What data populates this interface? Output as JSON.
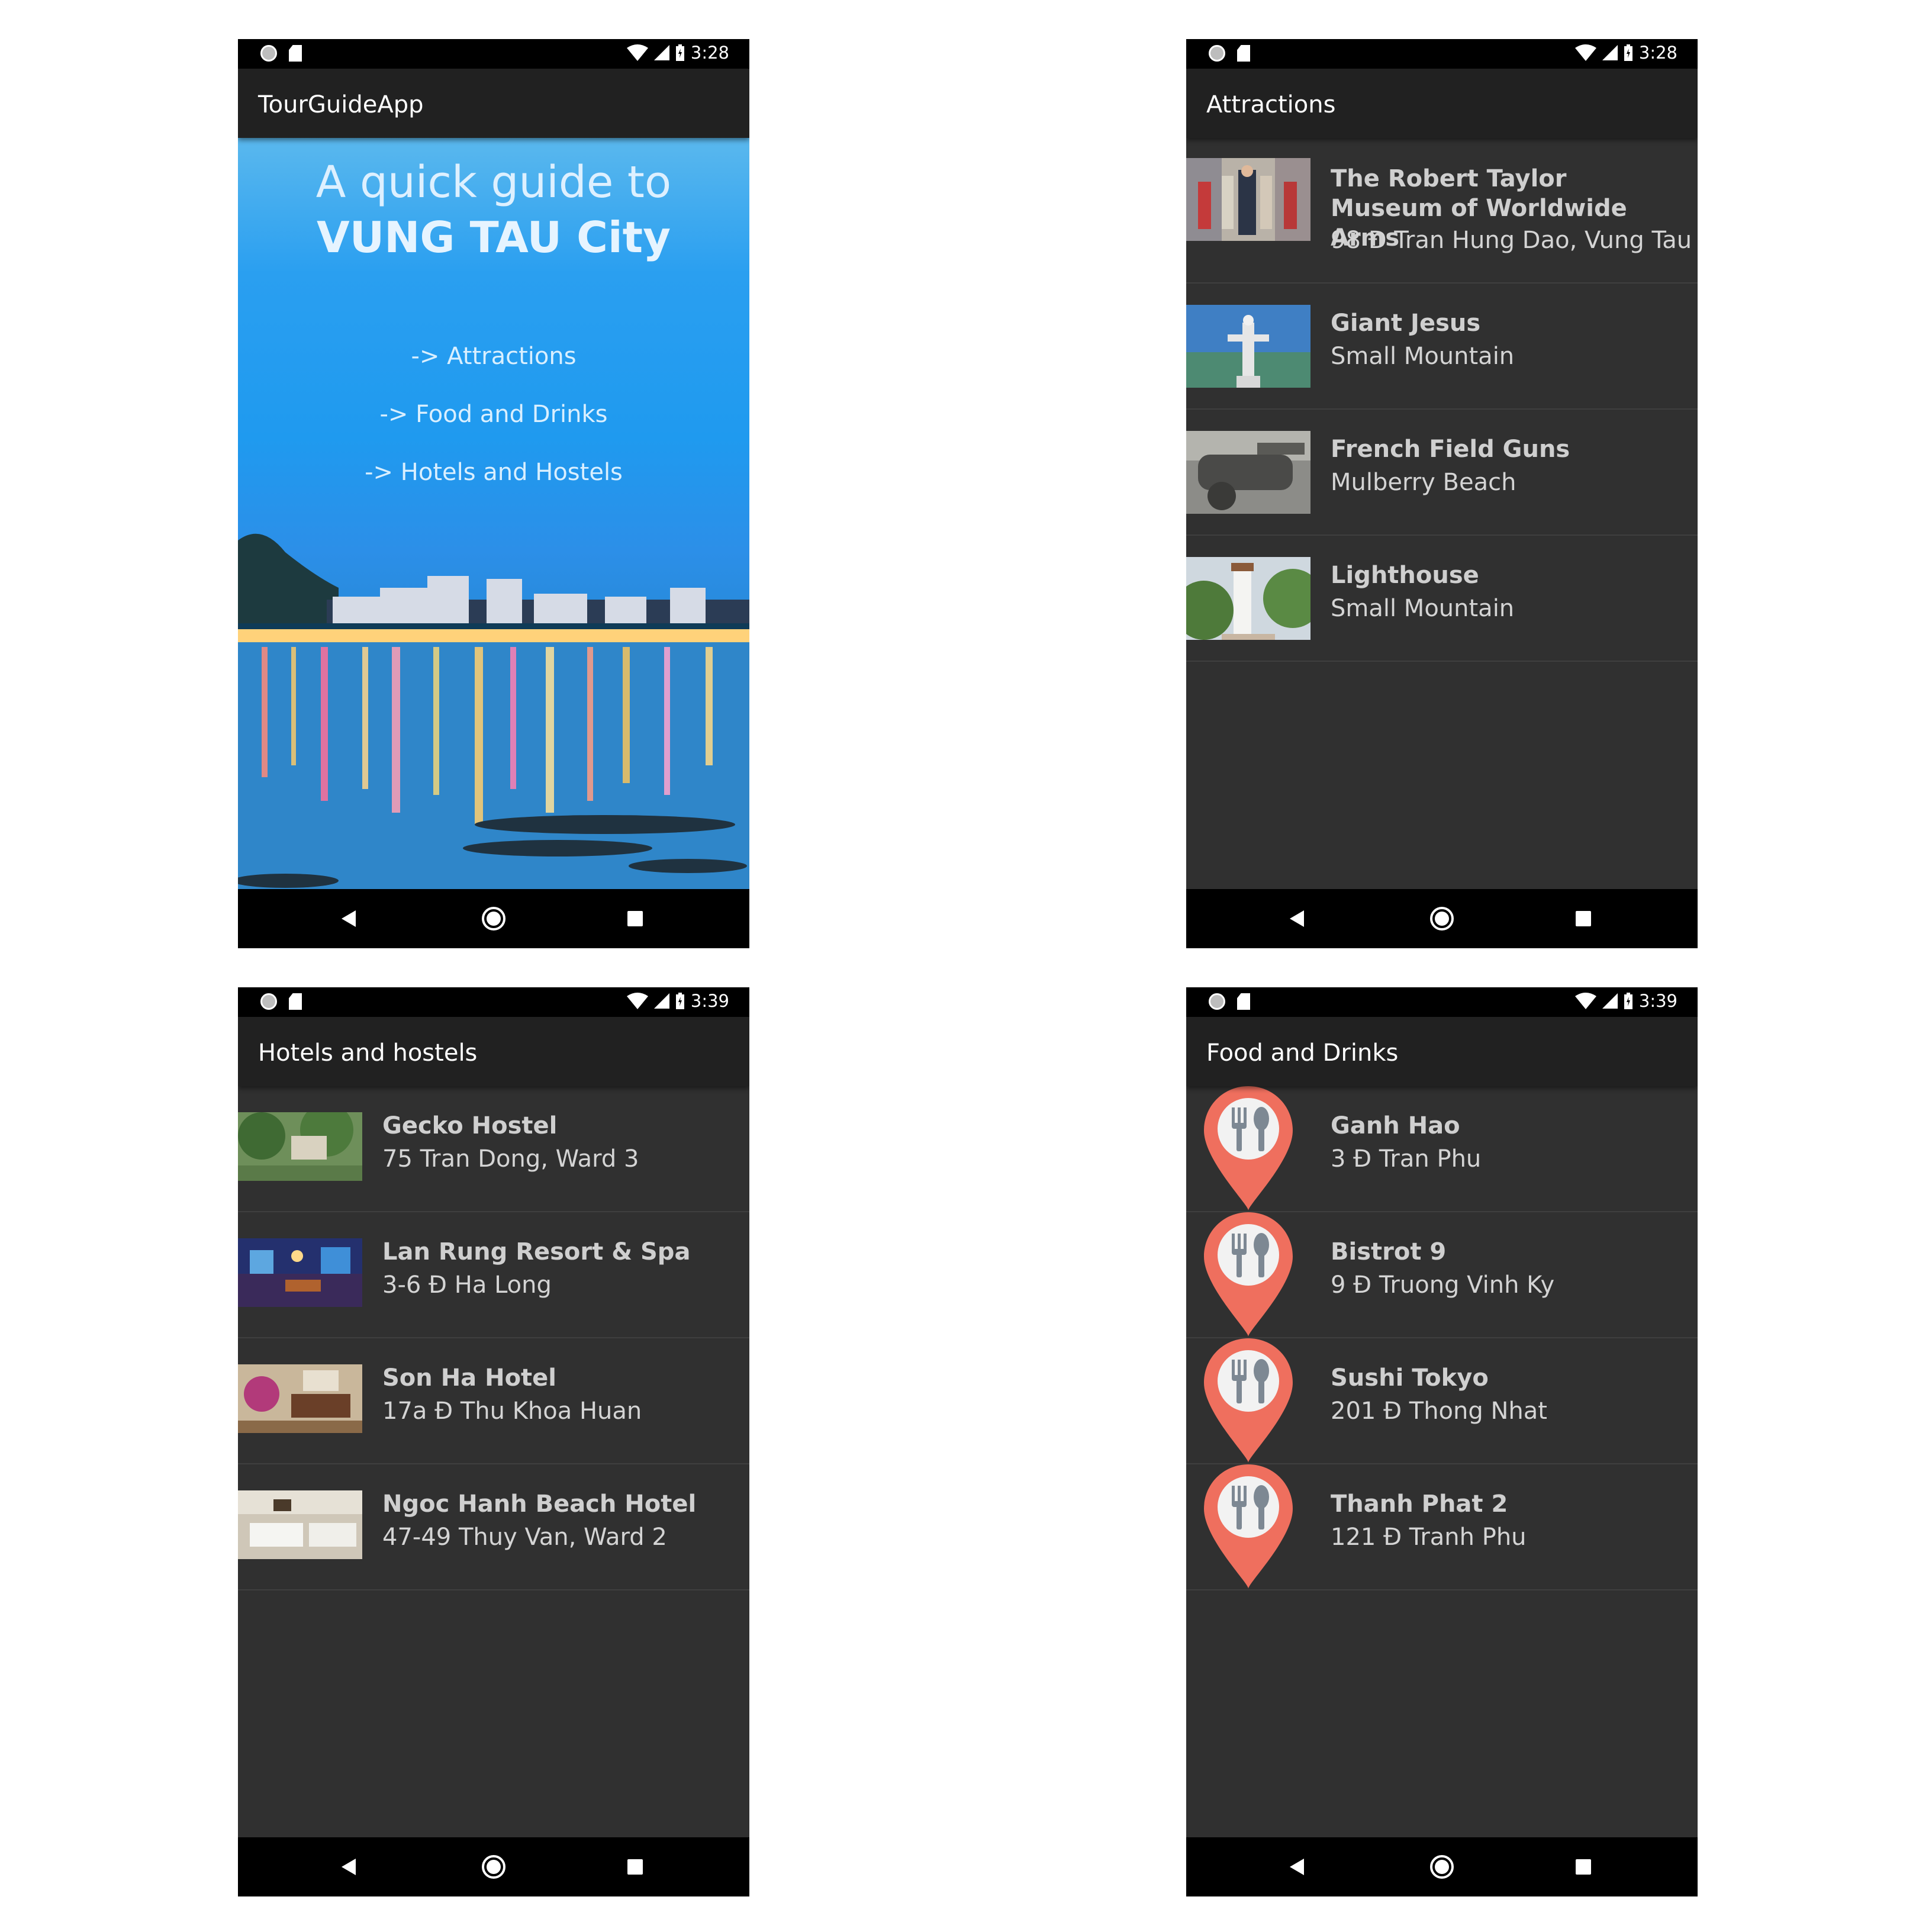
{
  "status": {
    "time_top": "3:28",
    "time_bottom": "3:39"
  },
  "home": {
    "app_title": "TourGuideApp",
    "headline_line1": "A quick guide to",
    "headline_line2": "VUNG TAU City",
    "links": [
      "-> Attractions",
      "-> Food and Drinks",
      "-> Hotels and Hostels"
    ]
  },
  "attractions": {
    "app_title": "Attractions",
    "items": [
      {
        "title": "The Robert Taylor Museum of Worldwide Arms",
        "subtitle": "98 Đ Tran Hung Dao, Vung Tau"
      },
      {
        "title": "Giant Jesus",
        "subtitle": "Small Mountain"
      },
      {
        "title": "French Field Guns",
        "subtitle": "Mulberry Beach"
      },
      {
        "title": "Lighthouse",
        "subtitle": "Small Mountain"
      }
    ]
  },
  "hotels": {
    "app_title": "Hotels and hostels",
    "items": [
      {
        "title": "Gecko Hostel",
        "subtitle": "75 Tran Dong, Ward 3"
      },
      {
        "title": "Lan Rung Resort & Spa",
        "subtitle": "3-6 Đ Ha Long"
      },
      {
        "title": "Son Ha Hotel",
        "subtitle": "17a Đ Thu Khoa Huan"
      },
      {
        "title": "Ngoc Hanh Beach Hotel",
        "subtitle": "47-49 Thuy Van, Ward 2"
      }
    ]
  },
  "food": {
    "app_title": "Food and Drinks",
    "items": [
      {
        "title": "Ganh Hao",
        "subtitle": "3 Đ Tran Phu"
      },
      {
        "title": "Bistrot 9",
        "subtitle": "9 Đ Truong Vinh Ky"
      },
      {
        "title": "Sushi Tokyo",
        "subtitle": "201 Đ Thong Nhat"
      },
      {
        "title": "Thanh Phat 2",
        "subtitle": "121 Đ Tranh Phu"
      }
    ]
  },
  "icons": {
    "pin_color": "#ef6f5e",
    "cutlery_color": "#7d8893"
  }
}
